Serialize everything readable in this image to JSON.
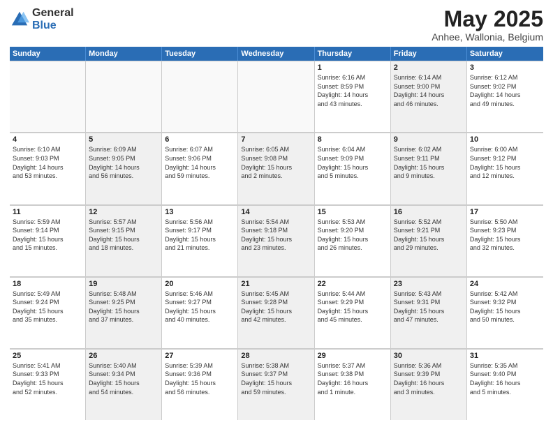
{
  "logo": {
    "general": "General",
    "blue": "Blue"
  },
  "header": {
    "month": "May 2025",
    "location": "Anhee, Wallonia, Belgium"
  },
  "weekdays": [
    "Sunday",
    "Monday",
    "Tuesday",
    "Wednesday",
    "Thursday",
    "Friday",
    "Saturday"
  ],
  "weeks": [
    [
      {
        "day": "",
        "info": "",
        "shaded": false,
        "empty": true
      },
      {
        "day": "",
        "info": "",
        "shaded": false,
        "empty": true
      },
      {
        "day": "",
        "info": "",
        "shaded": false,
        "empty": true
      },
      {
        "day": "",
        "info": "",
        "shaded": false,
        "empty": true
      },
      {
        "day": "1",
        "info": "Sunrise: 6:16 AM\nSunset: 8:59 PM\nDaylight: 14 hours\nand 43 minutes.",
        "shaded": false,
        "empty": false
      },
      {
        "day": "2",
        "info": "Sunrise: 6:14 AM\nSunset: 9:00 PM\nDaylight: 14 hours\nand 46 minutes.",
        "shaded": true,
        "empty": false
      },
      {
        "day": "3",
        "info": "Sunrise: 6:12 AM\nSunset: 9:02 PM\nDaylight: 14 hours\nand 49 minutes.",
        "shaded": false,
        "empty": false
      }
    ],
    [
      {
        "day": "4",
        "info": "Sunrise: 6:10 AM\nSunset: 9:03 PM\nDaylight: 14 hours\nand 53 minutes.",
        "shaded": false,
        "empty": false
      },
      {
        "day": "5",
        "info": "Sunrise: 6:09 AM\nSunset: 9:05 PM\nDaylight: 14 hours\nand 56 minutes.",
        "shaded": true,
        "empty": false
      },
      {
        "day": "6",
        "info": "Sunrise: 6:07 AM\nSunset: 9:06 PM\nDaylight: 14 hours\nand 59 minutes.",
        "shaded": false,
        "empty": false
      },
      {
        "day": "7",
        "info": "Sunrise: 6:05 AM\nSunset: 9:08 PM\nDaylight: 15 hours\nand 2 minutes.",
        "shaded": true,
        "empty": false
      },
      {
        "day": "8",
        "info": "Sunrise: 6:04 AM\nSunset: 9:09 PM\nDaylight: 15 hours\nand 5 minutes.",
        "shaded": false,
        "empty": false
      },
      {
        "day": "9",
        "info": "Sunrise: 6:02 AM\nSunset: 9:11 PM\nDaylight: 15 hours\nand 9 minutes.",
        "shaded": true,
        "empty": false
      },
      {
        "day": "10",
        "info": "Sunrise: 6:00 AM\nSunset: 9:12 PM\nDaylight: 15 hours\nand 12 minutes.",
        "shaded": false,
        "empty": false
      }
    ],
    [
      {
        "day": "11",
        "info": "Sunrise: 5:59 AM\nSunset: 9:14 PM\nDaylight: 15 hours\nand 15 minutes.",
        "shaded": false,
        "empty": false
      },
      {
        "day": "12",
        "info": "Sunrise: 5:57 AM\nSunset: 9:15 PM\nDaylight: 15 hours\nand 18 minutes.",
        "shaded": true,
        "empty": false
      },
      {
        "day": "13",
        "info": "Sunrise: 5:56 AM\nSunset: 9:17 PM\nDaylight: 15 hours\nand 21 minutes.",
        "shaded": false,
        "empty": false
      },
      {
        "day": "14",
        "info": "Sunrise: 5:54 AM\nSunset: 9:18 PM\nDaylight: 15 hours\nand 23 minutes.",
        "shaded": true,
        "empty": false
      },
      {
        "day": "15",
        "info": "Sunrise: 5:53 AM\nSunset: 9:20 PM\nDaylight: 15 hours\nand 26 minutes.",
        "shaded": false,
        "empty": false
      },
      {
        "day": "16",
        "info": "Sunrise: 5:52 AM\nSunset: 9:21 PM\nDaylight: 15 hours\nand 29 minutes.",
        "shaded": true,
        "empty": false
      },
      {
        "day": "17",
        "info": "Sunrise: 5:50 AM\nSunset: 9:23 PM\nDaylight: 15 hours\nand 32 minutes.",
        "shaded": false,
        "empty": false
      }
    ],
    [
      {
        "day": "18",
        "info": "Sunrise: 5:49 AM\nSunset: 9:24 PM\nDaylight: 15 hours\nand 35 minutes.",
        "shaded": false,
        "empty": false
      },
      {
        "day": "19",
        "info": "Sunrise: 5:48 AM\nSunset: 9:25 PM\nDaylight: 15 hours\nand 37 minutes.",
        "shaded": true,
        "empty": false
      },
      {
        "day": "20",
        "info": "Sunrise: 5:46 AM\nSunset: 9:27 PM\nDaylight: 15 hours\nand 40 minutes.",
        "shaded": false,
        "empty": false
      },
      {
        "day": "21",
        "info": "Sunrise: 5:45 AM\nSunset: 9:28 PM\nDaylight: 15 hours\nand 42 minutes.",
        "shaded": true,
        "empty": false
      },
      {
        "day": "22",
        "info": "Sunrise: 5:44 AM\nSunset: 9:29 PM\nDaylight: 15 hours\nand 45 minutes.",
        "shaded": false,
        "empty": false
      },
      {
        "day": "23",
        "info": "Sunrise: 5:43 AM\nSunset: 9:31 PM\nDaylight: 15 hours\nand 47 minutes.",
        "shaded": true,
        "empty": false
      },
      {
        "day": "24",
        "info": "Sunrise: 5:42 AM\nSunset: 9:32 PM\nDaylight: 15 hours\nand 50 minutes.",
        "shaded": false,
        "empty": false
      }
    ],
    [
      {
        "day": "25",
        "info": "Sunrise: 5:41 AM\nSunset: 9:33 PM\nDaylight: 15 hours\nand 52 minutes.",
        "shaded": false,
        "empty": false
      },
      {
        "day": "26",
        "info": "Sunrise: 5:40 AM\nSunset: 9:34 PM\nDaylight: 15 hours\nand 54 minutes.",
        "shaded": true,
        "empty": false
      },
      {
        "day": "27",
        "info": "Sunrise: 5:39 AM\nSunset: 9:36 PM\nDaylight: 15 hours\nand 56 minutes.",
        "shaded": false,
        "empty": false
      },
      {
        "day": "28",
        "info": "Sunrise: 5:38 AM\nSunset: 9:37 PM\nDaylight: 15 hours\nand 59 minutes.",
        "shaded": true,
        "empty": false
      },
      {
        "day": "29",
        "info": "Sunrise: 5:37 AM\nSunset: 9:38 PM\nDaylight: 16 hours\nand 1 minute.",
        "shaded": false,
        "empty": false
      },
      {
        "day": "30",
        "info": "Sunrise: 5:36 AM\nSunset: 9:39 PM\nDaylight: 16 hours\nand 3 minutes.",
        "shaded": true,
        "empty": false
      },
      {
        "day": "31",
        "info": "Sunrise: 5:35 AM\nSunset: 9:40 PM\nDaylight: 16 hours\nand 5 minutes.",
        "shaded": false,
        "empty": false
      }
    ]
  ]
}
